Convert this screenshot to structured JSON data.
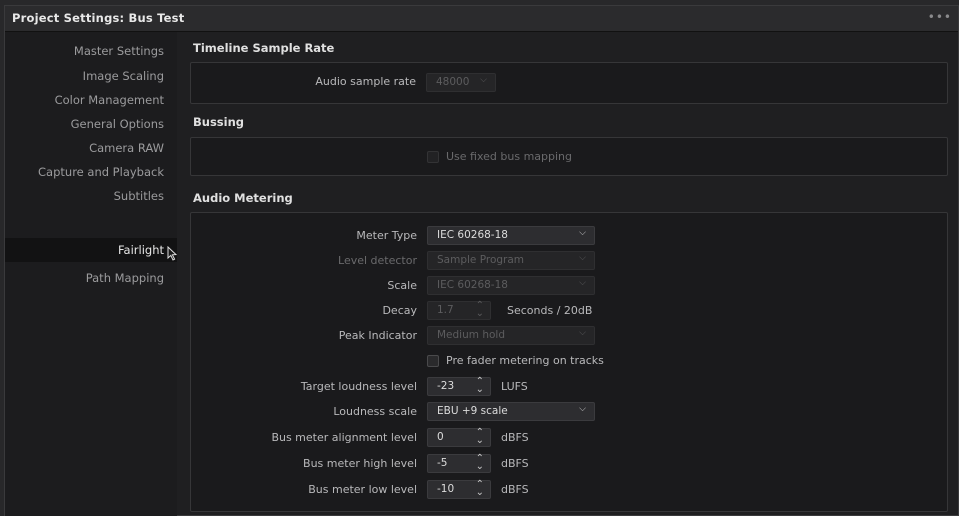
{
  "window": {
    "title": "Project Settings:  Bus Test",
    "menu_glyph": "•••"
  },
  "sidebar": {
    "items": [
      {
        "label": "Master Settings"
      },
      {
        "label": "Image Scaling"
      },
      {
        "label": "Color Management"
      },
      {
        "label": "General Options"
      },
      {
        "label": "Camera RAW"
      },
      {
        "label": "Capture and Playback"
      },
      {
        "label": "Subtitles"
      },
      {
        "label": "Fairlight",
        "active": true
      },
      {
        "label": "Path Mapping"
      }
    ]
  },
  "sections": {
    "sample_rate": {
      "heading": "Timeline Sample Rate",
      "audio_sample_rate_label": "Audio sample rate",
      "audio_sample_rate_value": "48000"
    },
    "bussing": {
      "heading": "Bussing",
      "fixed_bus_label": "Use fixed bus mapping"
    },
    "metering": {
      "heading": "Audio Metering",
      "meter_type_label": "Meter Type",
      "meter_type_value": "IEC 60268-18",
      "level_detector_label": "Level detector",
      "level_detector_value": "Sample Program",
      "scale_label": "Scale",
      "scale_value": "IEC 60268-18",
      "decay_label": "Decay",
      "decay_value": "1.7",
      "decay_unit": "Seconds / 20dB",
      "peak_indicator_label": "Peak Indicator",
      "peak_indicator_value": "Medium hold",
      "pre_fader_label": "Pre fader metering on tracks",
      "target_loudness_label": "Target loudness level",
      "target_loudness_value": "-23",
      "target_loudness_unit": "LUFS",
      "loudness_scale_label": "Loudness scale",
      "loudness_scale_value": "EBU +9 scale",
      "bus_align_label": "Bus meter alignment level",
      "bus_align_value": "0",
      "bus_align_unit": "dBFS",
      "bus_high_label": "Bus meter high level",
      "bus_high_value": "-5",
      "bus_high_unit": "dBFS",
      "bus_low_label": "Bus meter low level",
      "bus_low_value": "-10",
      "bus_low_unit": "dBFS"
    }
  }
}
